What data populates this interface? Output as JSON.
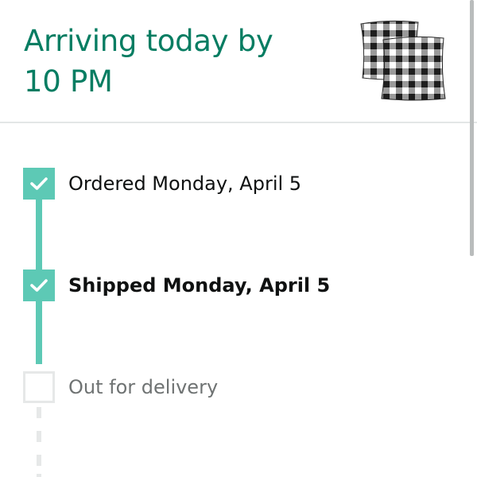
{
  "delivery": {
    "status_title_line1": "Arriving today by",
    "status_title_line2": "10 PM",
    "product_thumbnail_icon": "buffalo-check-pillows-image"
  },
  "tracker": {
    "steps": [
      {
        "label": "Ordered Monday, April 5",
        "state": "complete",
        "icon": "checkmark-icon"
      },
      {
        "label": "Shipped Monday, April 5",
        "state": "complete-current",
        "icon": "checkmark-icon"
      },
      {
        "label": "Out for delivery",
        "state": "pending",
        "icon": "empty-box"
      }
    ]
  },
  "colors": {
    "accent": "#067d62",
    "progress": "#5dc9b5",
    "pending": "#e6e8e8",
    "text": "#0f1111",
    "muted": "#6f7373"
  }
}
